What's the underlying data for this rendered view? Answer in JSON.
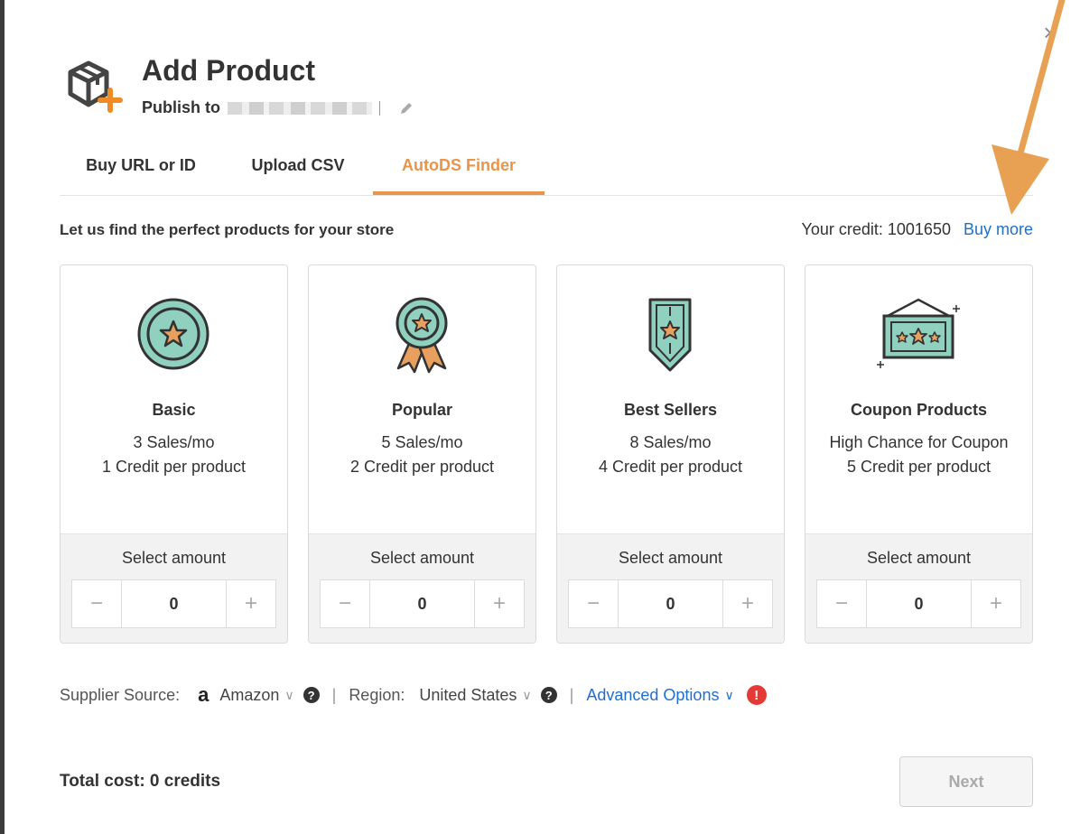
{
  "dialog": {
    "title": "Add Product",
    "publish_label": "Publish to",
    "close_glyph": "×"
  },
  "tabs": [
    {
      "label": "Buy URL or ID"
    },
    {
      "label": "Upload CSV"
    },
    {
      "label": "AutoDS Finder",
      "active": true
    }
  ],
  "finder": {
    "subtitle": "Let us find the perfect products for your store",
    "credit_label": "Your credit: 1001650",
    "buy_more": "Buy more"
  },
  "cards": [
    {
      "name": "Basic",
      "line1": "3 Sales/mo",
      "line2": "1 Credit per product",
      "select_label": "Select amount",
      "amount": "0",
      "icon": "coin-star-icon"
    },
    {
      "name": "Popular",
      "line1": "5 Sales/mo",
      "line2": "2 Credit per product",
      "select_label": "Select amount",
      "amount": "0",
      "icon": "ribbon-medal-icon"
    },
    {
      "name": "Best Sellers",
      "line1": "8 Sales/mo",
      "line2": "4 Credit per product",
      "select_label": "Select amount",
      "amount": "0",
      "icon": "shield-star-icon"
    },
    {
      "name": "Coupon Products",
      "line1": "High Chance for Coupon",
      "line2": "5 Credit per product",
      "select_label": "Select amount",
      "amount": "0",
      "icon": "coupon-ticket-icon"
    }
  ],
  "stepper": {
    "minus": "−",
    "plus": "+"
  },
  "options": {
    "supplier_label": "Supplier Source:",
    "amazon_glyph": "a",
    "supplier_value": "Amazon",
    "region_label": "Region:",
    "region_value": "United States",
    "advanced": "Advanced Options",
    "chevron": "∨",
    "help": "?",
    "warn": "!",
    "separator": "|"
  },
  "footer": {
    "total": "Total cost: 0 credits",
    "next": "Next"
  },
  "colors": {
    "accent": "#e8954a",
    "link": "#1f6fd0",
    "teal": "#8fd0bf",
    "warning": "#e53935"
  }
}
